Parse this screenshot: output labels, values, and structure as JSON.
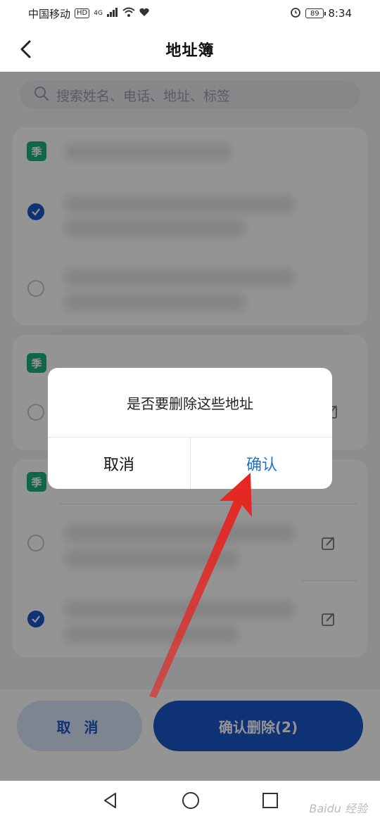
{
  "status_bar": {
    "carrier": "中国移动",
    "hd_badge": "HD",
    "network": "4G",
    "battery": "89",
    "time": "8:34"
  },
  "header": {
    "title": "地址簿",
    "back_icon": "chevron-left-icon"
  },
  "search": {
    "placeholder": "搜索姓名、电话、地址、标签"
  },
  "cards": [
    {
      "tag": "季",
      "rows": [
        {
          "checked": true
        },
        {
          "checked": false
        }
      ]
    },
    {
      "tag": "季",
      "rows": [
        {
          "checked": false
        }
      ]
    },
    {
      "tag": "季",
      "rows": [
        {
          "checked": false
        },
        {
          "checked": true
        }
      ]
    }
  ],
  "bottom": {
    "cancel_label": "取 消",
    "confirm_label": "确认删除(2)"
  },
  "dialog": {
    "message": "是否要删除这些地址",
    "cancel_label": "取消",
    "confirm_label": "确认"
  },
  "watermark": "Baidu 经验",
  "colors": {
    "accent": "#1a56c9",
    "tag_green": "#1db07a",
    "dialog_confirm": "#1a73c9",
    "arrow_red": "#e8231f"
  }
}
